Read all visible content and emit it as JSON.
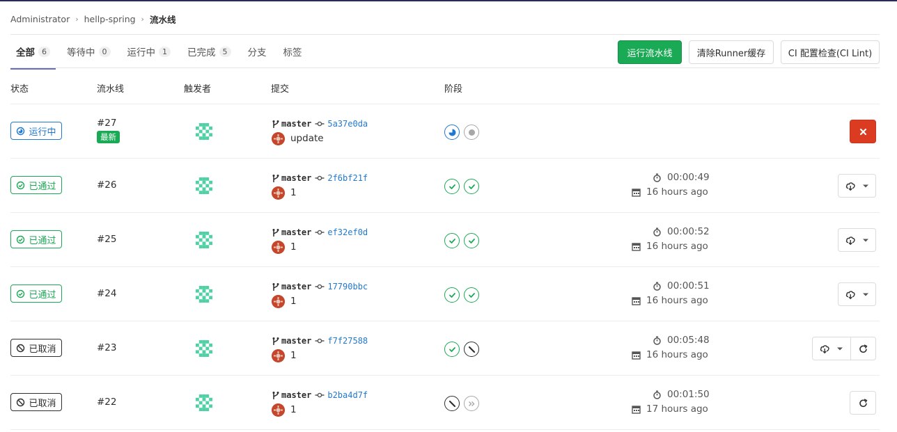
{
  "breadcrumb": {
    "items": [
      "Administrator",
      "hellp-spring"
    ],
    "current": "流水线"
  },
  "tabs": [
    {
      "label": "全部",
      "count": "6",
      "active": true
    },
    {
      "label": "等待中",
      "count": "0"
    },
    {
      "label": "运行中",
      "count": "1"
    },
    {
      "label": "已完成",
      "count": "5"
    },
    {
      "label": "分支"
    },
    {
      "label": "标签"
    }
  ],
  "actions": {
    "run": "运行流水线",
    "clear_cache": "清除Runner缓存",
    "ci_lint": "CI 配置检查(CI Lint)"
  },
  "table": {
    "headers": {
      "status": "状态",
      "pipeline": "流水线",
      "triggerer": "触发者",
      "commit": "提交",
      "stages": "阶段"
    }
  },
  "colors": {
    "running": "#1f78d1",
    "passed": "#1aaa55",
    "canceled": "#2e2e2e",
    "danger": "#db3b21",
    "avatar": "#c5462b",
    "identicon": "#4fd1a3"
  },
  "pipelines": [
    {
      "status": "运行中",
      "status_kind": "running",
      "id": "#27",
      "latest": "最新",
      "ref": "master",
      "sha": "5a37e0da",
      "message": "update",
      "stages": [
        "running",
        "created"
      ],
      "action": "cancel"
    },
    {
      "status": "已通过",
      "status_kind": "passed",
      "id": "#26",
      "ref": "master",
      "sha": "2f6bf21f",
      "message": "1",
      "stages": [
        "success",
        "success"
      ],
      "duration": "00:00:49",
      "finished": "16 hours ago",
      "action": "download"
    },
    {
      "status": "已通过",
      "status_kind": "passed",
      "id": "#25",
      "ref": "master",
      "sha": "ef32ef0d",
      "message": "1",
      "stages": [
        "success",
        "success"
      ],
      "duration": "00:00:52",
      "finished": "16 hours ago",
      "action": "download"
    },
    {
      "status": "已通过",
      "status_kind": "passed",
      "id": "#24",
      "ref": "master",
      "sha": "17790bbc",
      "message": "1",
      "stages": [
        "success",
        "success"
      ],
      "duration": "00:00:51",
      "finished": "16 hours ago",
      "action": "download"
    },
    {
      "status": "已取消",
      "status_kind": "canceled",
      "id": "#23",
      "ref": "master",
      "sha": "f7f27588",
      "message": "1",
      "stages": [
        "success",
        "canceled"
      ],
      "duration": "00:05:48",
      "finished": "16 hours ago",
      "action": "download-retry"
    },
    {
      "status": "已取消",
      "status_kind": "canceled",
      "id": "#22",
      "ref": "master",
      "sha": "b2ba4d7f",
      "message": "1",
      "stages": [
        "canceled",
        "skipped"
      ],
      "duration": "00:01:50",
      "finished": "17 hours ago",
      "action": "retry"
    }
  ]
}
